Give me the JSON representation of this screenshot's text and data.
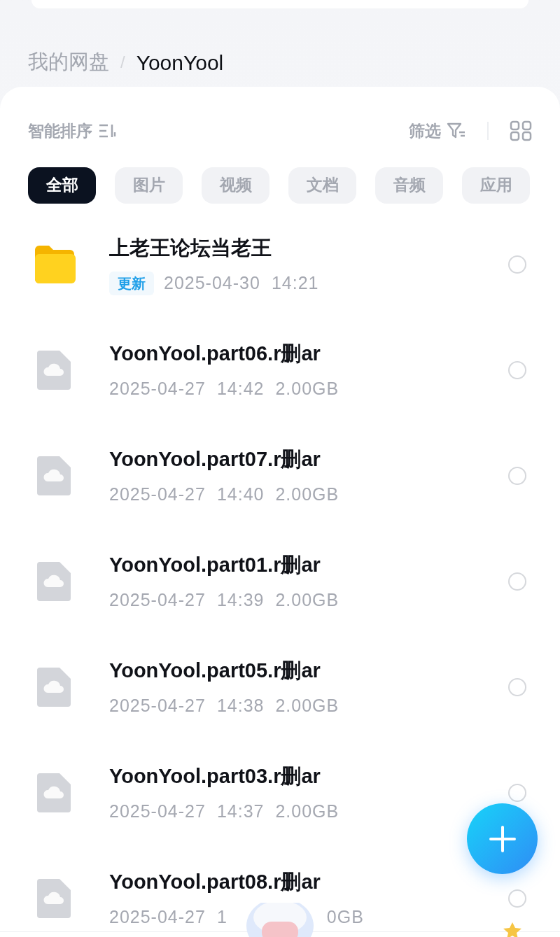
{
  "breadcrumb": {
    "separator": "/",
    "items": [
      {
        "label": "我的网盘",
        "current": false
      },
      {
        "label": "YoonYool",
        "current": true
      }
    ]
  },
  "toolbar": {
    "sort_label": "智能排序",
    "filter_label": "筛选"
  },
  "categories": [
    {
      "label": "全部",
      "selected": true
    },
    {
      "label": "图片",
      "selected": false
    },
    {
      "label": "视频",
      "selected": false
    },
    {
      "label": "文档",
      "selected": false
    },
    {
      "label": "音频",
      "selected": false
    },
    {
      "label": "应用",
      "selected": false
    }
  ],
  "files": [
    {
      "kind": "folder",
      "name": "上老王论坛当老王",
      "badge": "更新",
      "date": "2025-04-30",
      "time": "14:21",
      "selected": false
    },
    {
      "kind": "file",
      "name": "YoonYool.part06.r删ar",
      "date": "2025-04-27",
      "time": "14:42",
      "size": "2.00GB",
      "selected": false
    },
    {
      "kind": "file",
      "name": "YoonYool.part07.r删ar",
      "date": "2025-04-27",
      "time": "14:40",
      "size": "2.00GB",
      "selected": false
    },
    {
      "kind": "file",
      "name": "YoonYool.part01.r删ar",
      "date": "2025-04-27",
      "time": "14:39",
      "size": "2.00GB",
      "selected": false
    },
    {
      "kind": "file",
      "name": "YoonYool.part05.r删ar",
      "date": "2025-04-27",
      "time": "14:38",
      "size": "2.00GB",
      "selected": false
    },
    {
      "kind": "file",
      "name": "YoonYool.part03.r删ar",
      "date": "2025-04-27",
      "time": "14:37",
      "size": "2.00GB",
      "selected": false
    },
    {
      "kind": "file",
      "name": "YoonYool.part08.r删ar",
      "date": "2025-04-27",
      "time": "1",
      "size": "0GB",
      "selected": false
    }
  ]
}
